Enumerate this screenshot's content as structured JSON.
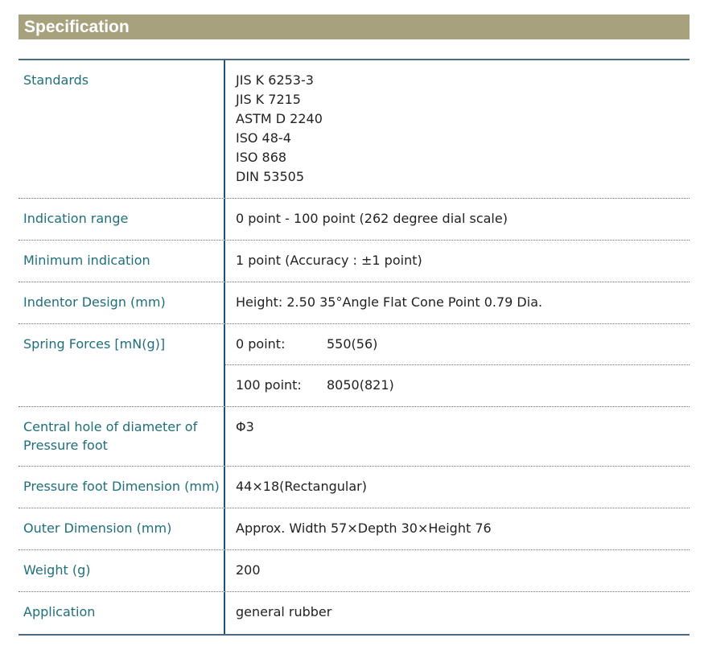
{
  "header": {
    "title": "Specification"
  },
  "spec": {
    "standards": {
      "label": "Standards",
      "values": [
        "JIS K 6253-3",
        "JIS K 7215",
        "ASTM D 2240",
        "ISO 48-4",
        "ISO 868",
        "DIN 53505"
      ]
    },
    "indication_range": {
      "label": "Indication range",
      "value": "0 point - 100 point (262 degree dial scale)"
    },
    "minimum_indication": {
      "label": "Minimum indication",
      "value": "1 point (Accuracy : ±1 point)"
    },
    "indentor_design": {
      "label": "Indentor Design (mm)",
      "value": "Height: 2.50 35°Angle Flat Cone Point 0.79 Dia."
    },
    "spring_forces": {
      "label": "Spring Forces [mN(g)]",
      "rows": [
        {
          "point": "0 point:",
          "force": "550(56)"
        },
        {
          "point": "100 point:",
          "force": "8050(821)"
        }
      ]
    },
    "central_hole": {
      "label": "Central hole of diameter of Pressure foot",
      "value": "Φ3"
    },
    "pressure_foot_dimension": {
      "label": "Pressure foot Dimension (mm)",
      "value": "44×18(Rectangular)"
    },
    "outer_dimension": {
      "label": "Outer Dimension (mm)",
      "value": "Approx. Width 57×Depth 30×Height 76"
    },
    "weight": {
      "label": "Weight (g)",
      "value": "200"
    },
    "application": {
      "label": "Application",
      "value": "general rubber"
    }
  },
  "colors": {
    "banner_bg": "#a8a17e",
    "label_text": "#1f6f7a",
    "rule": "#4b6a86"
  }
}
